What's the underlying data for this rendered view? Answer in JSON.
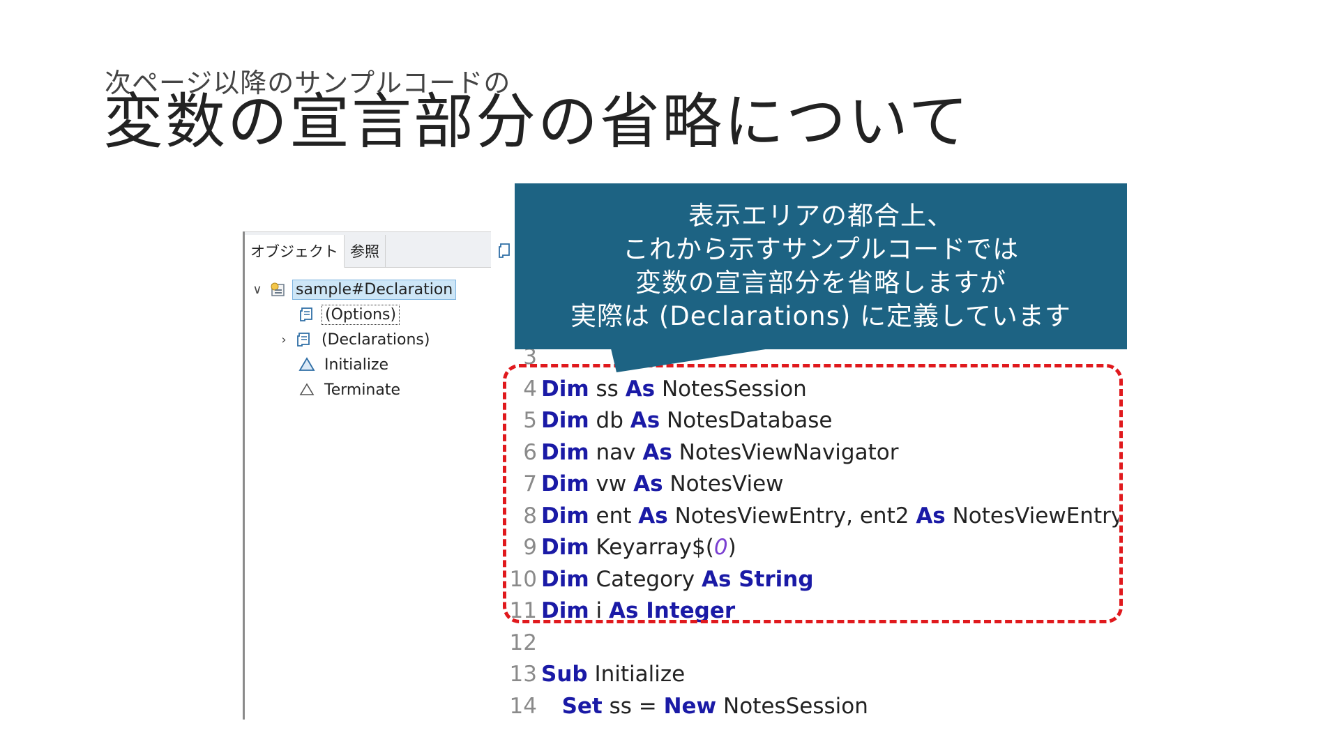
{
  "slide": {
    "subtitle": "次ページ以降のサンプルコードの",
    "title": "変数の宣言部分の省略について"
  },
  "panel": {
    "tabs": [
      {
        "label": "オブジェクト"
      },
      {
        "label": "参照"
      }
    ],
    "tree": [
      {
        "label": "sample#Declaration",
        "icon": "database-icon"
      },
      {
        "label": "(Options)",
        "icon": "script-icon"
      },
      {
        "label": "(Declarations)",
        "icon": "script-icon"
      },
      {
        "label": "Initialize",
        "icon": "triangle-icon"
      },
      {
        "label": "Terminate",
        "icon": "triangle-outline-icon"
      }
    ]
  },
  "callout": {
    "lines": [
      "表示エリアの都合上、",
      "これから示すサンプルコードでは",
      "変数の宣言部分を省略しますが",
      "実際は (Declarations) に定義しています"
    ]
  },
  "code": {
    "lines": [
      {
        "n": "3",
        "tokens": []
      },
      {
        "n": "4",
        "tokens": [
          {
            "t": "Dim",
            "k": "kw"
          },
          {
            "t": " ss "
          },
          {
            "t": "As",
            "k": "kw"
          },
          {
            "t": " NotesSession"
          }
        ]
      },
      {
        "n": "5",
        "tokens": [
          {
            "t": "Dim",
            "k": "kw"
          },
          {
            "t": " db "
          },
          {
            "t": "As",
            "k": "kw"
          },
          {
            "t": " NotesDatabase"
          }
        ]
      },
      {
        "n": "6",
        "tokens": [
          {
            "t": "Dim",
            "k": "kw"
          },
          {
            "t": " nav "
          },
          {
            "t": "As",
            "k": "kw"
          },
          {
            "t": " NotesViewNavigator"
          }
        ]
      },
      {
        "n": "7",
        "tokens": [
          {
            "t": "Dim",
            "k": "kw"
          },
          {
            "t": " vw "
          },
          {
            "t": "As",
            "k": "kw"
          },
          {
            "t": " NotesView"
          }
        ]
      },
      {
        "n": "8",
        "tokens": [
          {
            "t": "Dim",
            "k": "kw"
          },
          {
            "t": " ent "
          },
          {
            "t": "As",
            "k": "kw"
          },
          {
            "t": " NotesViewEntry, ent2 "
          },
          {
            "t": "As",
            "k": "kw"
          },
          {
            "t": " NotesViewEntry"
          }
        ]
      },
      {
        "n": "9",
        "tokens": [
          {
            "t": "Dim",
            "k": "kw"
          },
          {
            "t": " Keyarray$("
          },
          {
            "t": "0",
            "k": "num"
          },
          {
            "t": ")"
          }
        ]
      },
      {
        "n": "10",
        "tokens": [
          {
            "t": "Dim",
            "k": "kw"
          },
          {
            "t": " Category "
          },
          {
            "t": "As String",
            "k": "kw"
          }
        ]
      },
      {
        "n": "11",
        "tokens": [
          {
            "t": "Dim",
            "k": "kw"
          },
          {
            "t": " i "
          },
          {
            "t": "As Integer",
            "k": "kw"
          }
        ]
      },
      {
        "n": "12",
        "tokens": []
      },
      {
        "n": "13",
        "tokens": [
          {
            "t": "Sub",
            "k": "kw"
          },
          {
            "t": " Initialize"
          }
        ]
      },
      {
        "n": "14",
        "tokens": [
          {
            "t": "   "
          },
          {
            "t": "Set",
            "k": "kw"
          },
          {
            "t": " ss = "
          },
          {
            "t": "New",
            "k": "kw"
          },
          {
            "t": " NotesSession"
          }
        ]
      }
    ]
  },
  "colors": {
    "callout_bg": "#1d6383",
    "keyword": "#1a1aa6",
    "highlight_border": "#e0191d"
  }
}
